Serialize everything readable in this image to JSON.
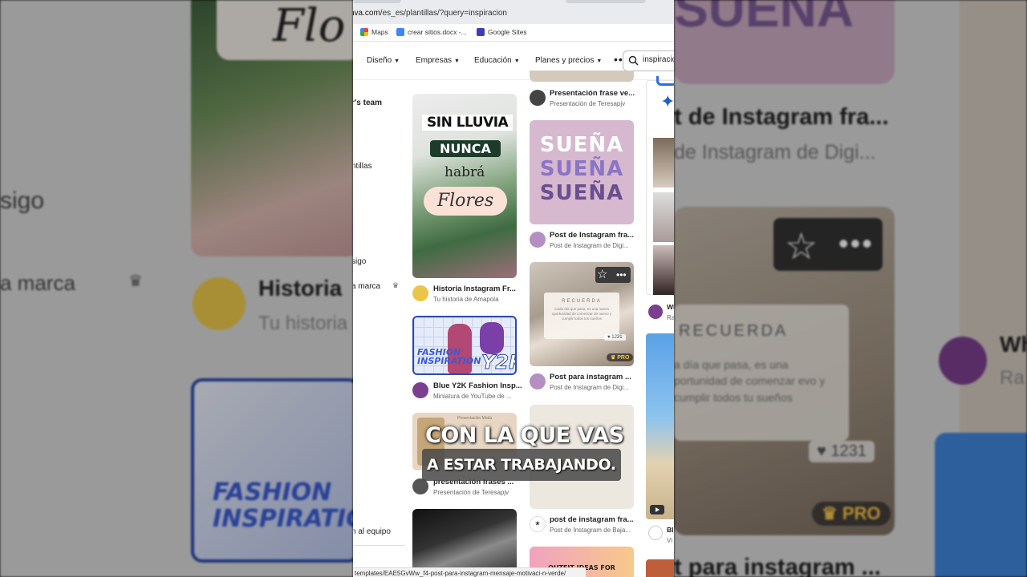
{
  "background": {
    "left": {
      "texts": [
        "sigo",
        "a marca"
      ],
      "hist_title": "Historia",
      "hist_sub": "Tu historia",
      "flores": "Flo",
      "fashion": "FASHION INSPIRATION"
    },
    "right": {
      "suena": "SUEÑA",
      "title1": "t de Instagram fra...",
      "title2": "de Instagram de Digi...",
      "recuerda": "RECUERDA",
      "recuerda_body": "a día que pasa, es una portunidad de comenzar evo y cumplir todos tu sueños",
      "likes": "1231",
      "pro": "PRO",
      "wh": "Wh",
      "ra": "Ra",
      "title3": "t para instagram ..."
    }
  },
  "browser": {
    "url_host": "nva.com",
    "url_path": "/es_es/plantillas/?query=inspiracion",
    "bookmarks": [
      "Maps",
      "crear sitios.docx -...",
      "Google Sites"
    ],
    "nav": [
      "Diseño",
      "Empresas",
      "Educación",
      "Planes y precios"
    ],
    "search_value": "inspiracion",
    "status_url": "templates/EAE5GvWw_f4-post-para-instagram-mensaje-motivaci-n-verde/"
  },
  "sidebar": {
    "team": "r's team",
    "plantillas": "ntillas",
    "sigo": "sigo",
    "marca": "a marca",
    "equipo": "n al equipo"
  },
  "cards": {
    "c1": {
      "line1": "SIN LLUVIA",
      "line2": "NUNCA",
      "line3": "habrá",
      "line4": "Flores",
      "title": "Historia Instagram Fr...",
      "sub": "Tu historia de Amapola"
    },
    "c2": {
      "fashion": "FASHION",
      "inspiration": "INSPIRATION",
      "y2k": "Y2K",
      "title": "Blue Y2K Fashion Insp...",
      "sub": "Miniatura de YouTube de ..."
    },
    "c3": {
      "inner": "Presentación Moda",
      "title": "presentación frases ...",
      "sub": "Presentación de Teresapjv"
    },
    "c0": {
      "title": "Presentación frase ve...",
      "sub": "Presentación de Teresapjv"
    },
    "c5": {
      "words": [
        "SUEÑA",
        "SUEÑA",
        "SUEÑA"
      ],
      "title": "Post de Instagram fra...",
      "sub": "Post de Instagram de Digi..."
    },
    "c6": {
      "recuerda": "RECUERDA",
      "body": "Cada día que pasa, es una nueva oportunidad de comenzar de nuevo y cumplir todos tus sueños",
      "likes": "1231",
      "pro": "PRO",
      "title": "Post para instagram ...",
      "sub": "Post de Instagram de Digi..."
    },
    "c7": {
      "title": "post de instagram fra...",
      "sub": "Post de Instagram de Baja..."
    },
    "c8": {
      "text": "OUTFIT IDEAS FOR"
    },
    "sliver": {
      "wh": "Wh",
      "ra": "Ra",
      "bl": "Bl",
      "vi": "Vi"
    }
  },
  "caption": {
    "line1": "CON LA QUE VAS",
    "line2": "A ESTAR TRABAJANDO."
  },
  "colors": {
    "accent_blue": "#2c4aa8",
    "dark_green": "#1c3b2b",
    "suena_pink": "#d6b8cf",
    "pro_gold": "#f5c34a"
  }
}
